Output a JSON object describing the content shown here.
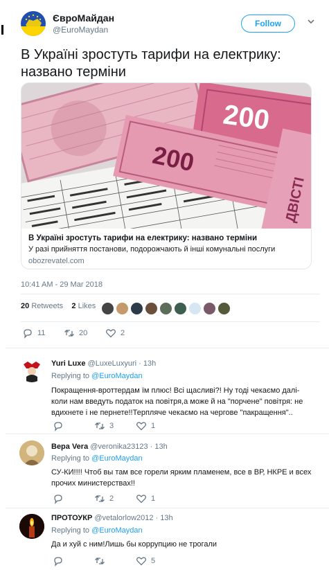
{
  "tweet": {
    "author_name": "ЄвроМайдан",
    "author_handle": "@EuroMaydan",
    "follow_label": "Follow",
    "text": "В Україні зростуть тарифи на електрику: названо терміни",
    "card": {
      "title": "В Україні зростуть тарифи на електрику: названо терміни",
      "description": "У разі прийняття постанови, подорожчають й інші комунальні послуги",
      "domain": "obozrevatel.com",
      "image_text": {
        "note_main": "200",
        "note_second": "200",
        "word_dvisti": "ДВІСТІ"
      }
    },
    "timestamp": "10:41 AM - 29 Mar 2018",
    "retweets_count": "20",
    "retweets_label": "Retweets",
    "likes_count": "2",
    "likes_label": "Likes",
    "actions": {
      "replies": "11",
      "retweets": "20",
      "likes": "2"
    }
  },
  "replies": [
    {
      "name": "Yuri Luxe",
      "handle": "@LuxeLuxyuri",
      "time": "· 13h",
      "replying_prefix": "Replying to",
      "replying_to": "@EuroMaydan",
      "text": "Покращення-вроттердам їм плюс! Всі щасливі?! Ну тоді чекаємо далі- коли нам введуть податок на повітря,а може й на \"порчене\" повітря: не вдихнете і не пернете!!Терпляче чекаємо на чергове \"пакращення\"..",
      "replies": "",
      "retweets": "3",
      "likes": "1"
    },
    {
      "name": "Вера Vera",
      "handle": "@veronika23123",
      "time": "· 13h",
      "replying_prefix": "Replying to",
      "replying_to": "@EuroMaydan",
      "text": "СУ-КИ!!!! Чтоб вы там все горели ярким пламенем, все в ВР, НКРЕ и всех прочих министерствах!!",
      "replies": "",
      "retweets": "2",
      "likes": "1"
    },
    {
      "name": "ПРОТОУКР",
      "handle": "@vetalorlow2012",
      "time": "· 13h",
      "replying_prefix": "Replying to",
      "replying_to": "@EuroMaydan",
      "text": "Да и хуй с ним!Лишь бы коррупцию не трогали",
      "replies": "",
      "retweets": "",
      "likes": "5"
    }
  ],
  "colors": {
    "accent": "#1da1f2",
    "secondary_text": "#657786",
    "primary_text": "#14171a",
    "divider": "#e6ecf0"
  },
  "icons": [
    "chevron-down-icon",
    "reply-icon",
    "retweet-icon",
    "heart-icon"
  ]
}
